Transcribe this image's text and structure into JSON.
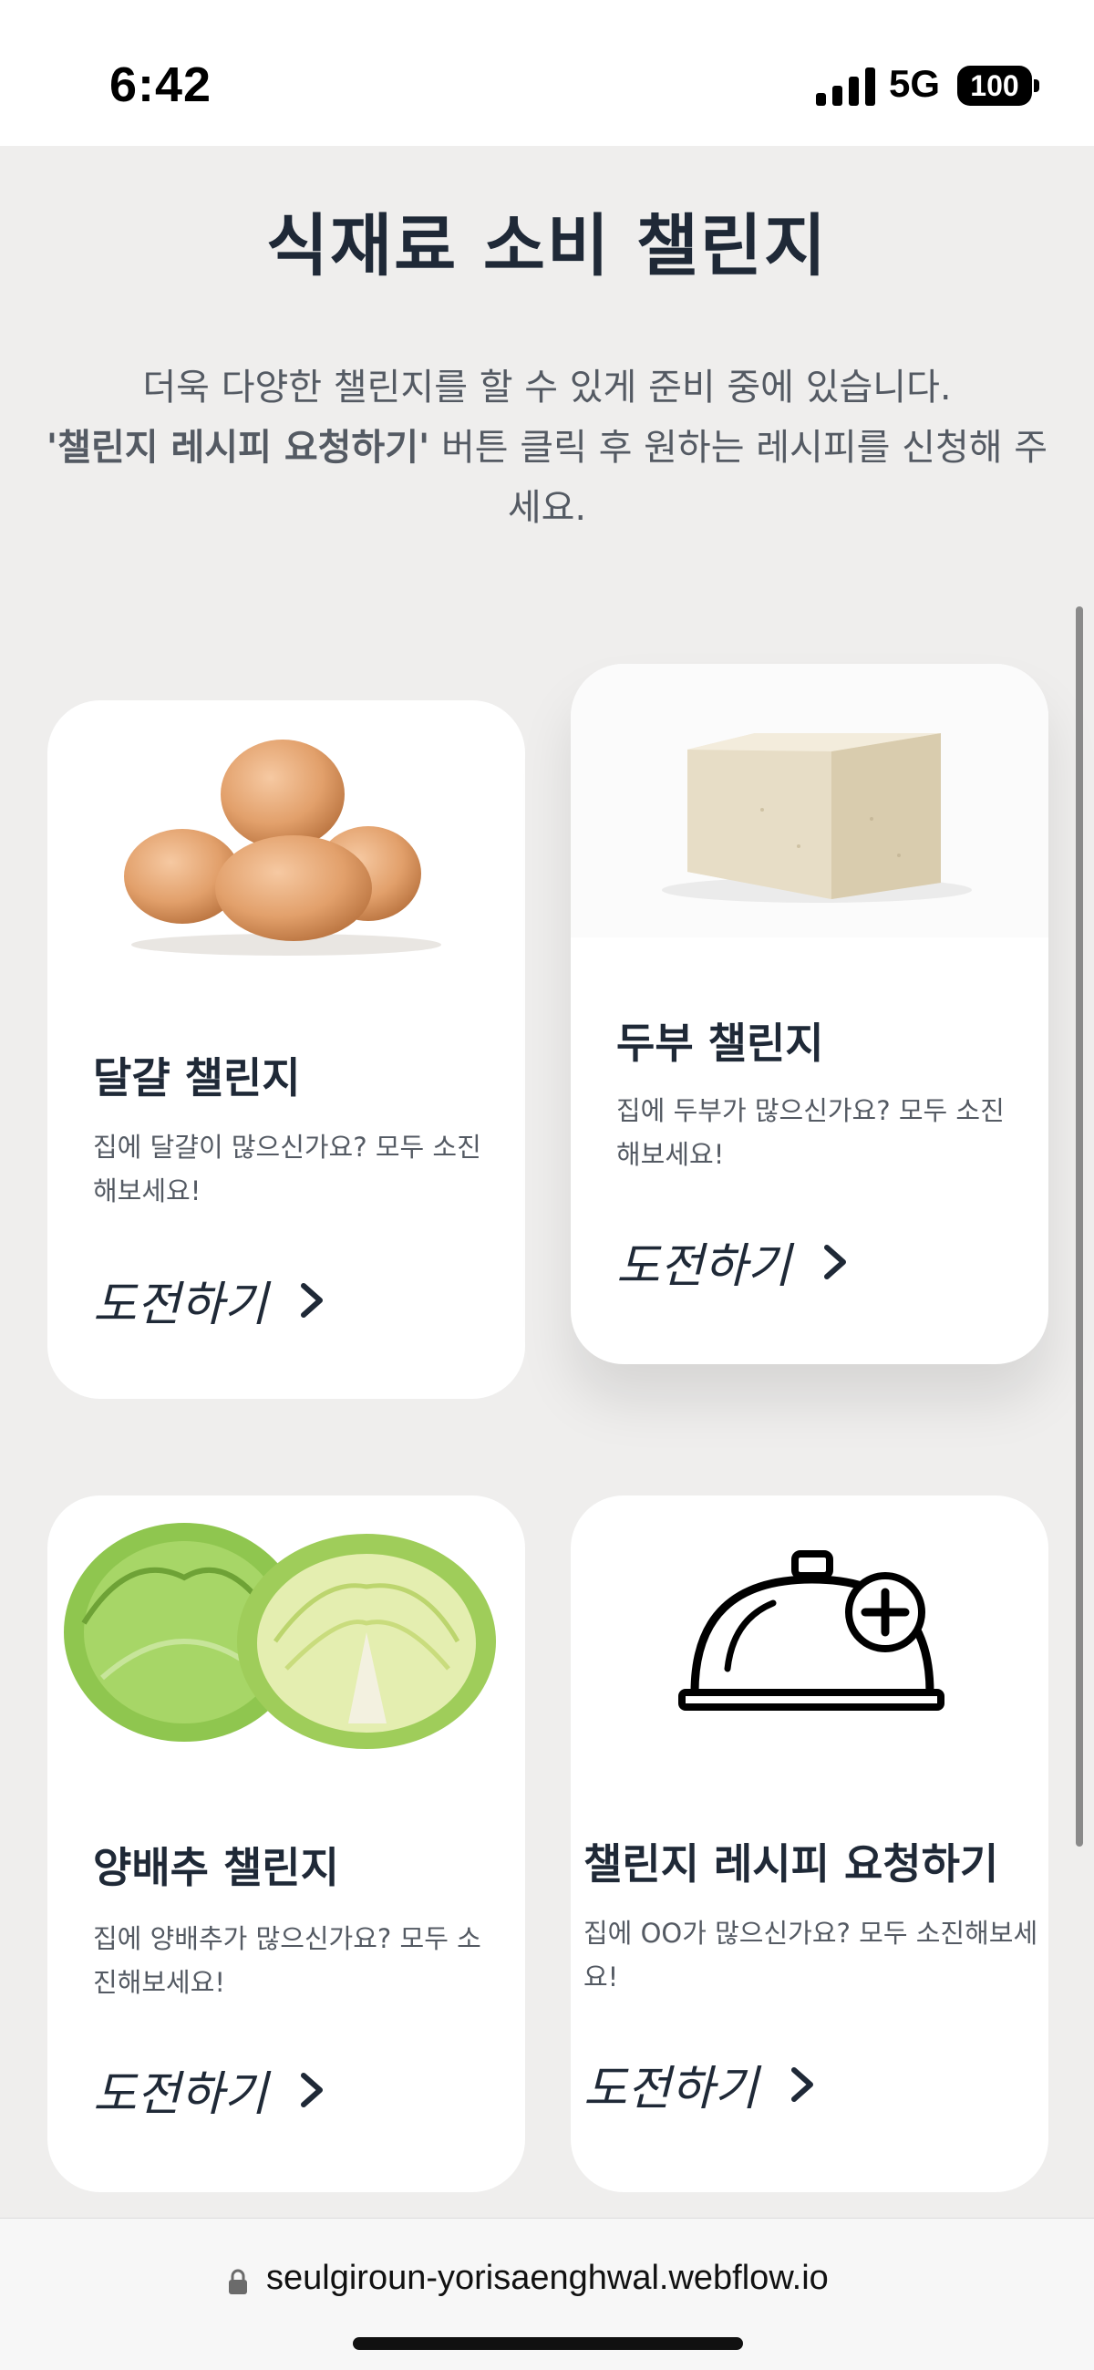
{
  "status_bar": {
    "time": "6:42",
    "network": "5G",
    "battery": "100",
    "signal_icon": "cellular-signal-icon"
  },
  "header": {
    "title": "식재료 소비 챌린지",
    "intro_line1": "더욱 다양한 챌린지를 할 수 있게 준비 중에 있습니다.",
    "intro_bold": "'챌린지 레시피 요청하기'",
    "intro_line2_rest": " 버튼 클릭 후 원하는 레시피를 신청해 주세요."
  },
  "cards": [
    {
      "image_icon": "eggs-image",
      "title": "달걀 챌린지",
      "desc": "집에 달걀이 많으신가요? 모두 소진해보세요!",
      "cta": "도전하기"
    },
    {
      "image_icon": "tofu-image",
      "title": "두부 챌린지",
      "desc": "집에 두부가 많으신가요? 모두 소진해보세요!",
      "cta": "도전하기"
    },
    {
      "image_icon": "cabbage-image",
      "title": "양배추 챌린지",
      "desc": "집에 양배추가 많으신가요? 모두 소진해보세요!",
      "cta": "도전하기"
    },
    {
      "image_icon": "cloche-plus-icon",
      "title": "챌린지 레시피 요청하기",
      "desc": "집에 OO가 많으신가요? 모두 소진해보세요!",
      "cta": "도전하기"
    }
  ],
  "url_bar": {
    "url": "seulgiroun-yorisaenghwal.webflow.io",
    "lock_icon": "lock-icon"
  },
  "colors": {
    "page_bg": "#efeeed",
    "card_bg": "#ffffff",
    "heading": "#1f2937",
    "body_text": "#545a63"
  }
}
